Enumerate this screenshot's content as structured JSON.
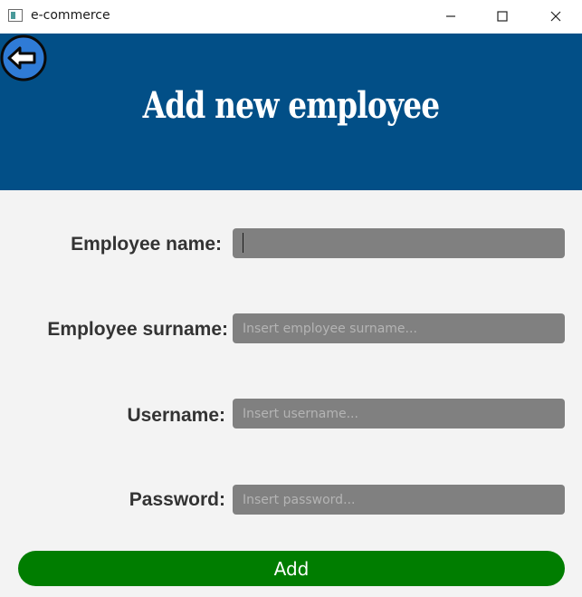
{
  "window": {
    "title": "e-commerce"
  },
  "header": {
    "title": "Add new employee",
    "background_color": "#024f87",
    "back_icon": "arrow-left-circle-icon"
  },
  "form": {
    "fields": [
      {
        "label": "Employee name:",
        "value": "",
        "placeholder": ""
      },
      {
        "label": "Employee surname:",
        "value": "",
        "placeholder": "Insert employee surname..."
      },
      {
        "label": "Username:",
        "value": "",
        "placeholder": "Insert username..."
      },
      {
        "label": "Password:",
        "value": "",
        "placeholder": "Insert password..."
      }
    ],
    "field_color": "#808080"
  },
  "actions": {
    "add_label": "Add",
    "add_color": "#007d00"
  }
}
